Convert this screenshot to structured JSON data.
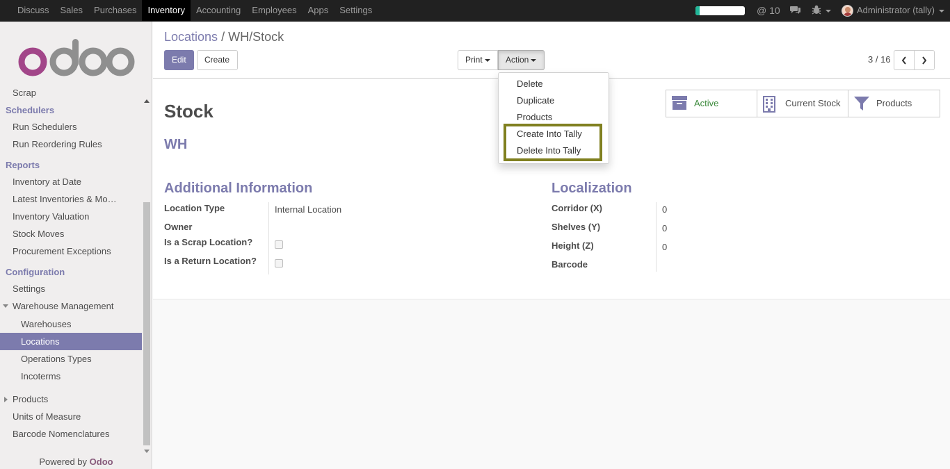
{
  "topbar": {
    "menu": [
      "Discuss",
      "Sales",
      "Purchases",
      "Inventory",
      "Accounting",
      "Employees",
      "Apps",
      "Settings"
    ],
    "active_menu": "Inventory",
    "progress_fraction": 0.08,
    "mail_label": "@ 10",
    "user_label": "Administrator (tally)",
    "icons": {
      "chat": "chat-bubbles-icon",
      "debug": "bug-icon",
      "avatar": "user-avatar"
    },
    "colors": {
      "bg": "#212121",
      "text": "#9d9d9d",
      "progress": "#21b799"
    }
  },
  "sidebar": {
    "items": [
      {
        "label": "Scrap",
        "type": "l1"
      },
      {
        "label": "Schedulers",
        "type": "head"
      },
      {
        "label": "Run Schedulers",
        "type": "l1"
      },
      {
        "label": "Run Reordering Rules",
        "type": "l1"
      },
      {
        "label": "Reports",
        "type": "head"
      },
      {
        "label": "Inventory at Date",
        "type": "l1"
      },
      {
        "label": "Latest Inventories & Mo…",
        "type": "l1"
      },
      {
        "label": "Inventory Valuation",
        "type": "l1"
      },
      {
        "label": "Stock Moves",
        "type": "l1"
      },
      {
        "label": "Procurement Exceptions",
        "type": "l1"
      },
      {
        "label": "Configuration",
        "type": "head"
      },
      {
        "label": "Settings",
        "type": "l1"
      },
      {
        "label": "Warehouse Management",
        "type": "l1"
      },
      {
        "label": "Warehouses",
        "type": "l2"
      },
      {
        "label": "Locations",
        "type": "l2"
      },
      {
        "label": "Operations Types",
        "type": "l2"
      },
      {
        "label": "Incoterms",
        "type": "l2"
      },
      {
        "label": "Products",
        "type": "l1"
      },
      {
        "label": "Units of Measure",
        "type": "l1"
      },
      {
        "label": "Barcode Nomenclatures",
        "type": "l1"
      }
    ],
    "selected": "Locations",
    "powered_by": "Powered by",
    "brand": "Odoo",
    "accent": "#7c7bad"
  },
  "control": {
    "breadcrumb_parent": "Locations",
    "breadcrumb_sep": "/",
    "breadcrumb_current": "WH/Stock",
    "edit_label": "Edit",
    "create_label": "Create",
    "print_label": "Print",
    "action_label": "Action",
    "pager_value": "3 / 16"
  },
  "action_menu": {
    "items": [
      "Delete",
      "Duplicate",
      "Products",
      "Create Into Tally",
      "Delete Into Tally"
    ],
    "highlight_color": "#808020"
  },
  "record": {
    "title": "Stock",
    "subtitle": "WH",
    "smart_buttons": [
      {
        "label": "Active",
        "icon": "archive-icon"
      },
      {
        "label": "Current Stock",
        "icon": "building-icon"
      },
      {
        "label": "Products",
        "icon": "filter-icon"
      }
    ],
    "additional_info": {
      "title": "Additional Information",
      "fields": [
        {
          "label": "Location Type",
          "value": "Internal Location"
        },
        {
          "label": "Owner",
          "value": ""
        },
        {
          "label": "Is a Scrap Location?",
          "value": false
        },
        {
          "label": "Is a Return Location?",
          "value": false
        }
      ]
    },
    "localization": {
      "title": "Localization",
      "fields": [
        {
          "label": "Corridor (X)",
          "value": "0"
        },
        {
          "label": "Shelves (Y)",
          "value": "0"
        },
        {
          "label": "Height (Z)",
          "value": "0"
        },
        {
          "label": "Barcode",
          "value": ""
        }
      ]
    }
  }
}
